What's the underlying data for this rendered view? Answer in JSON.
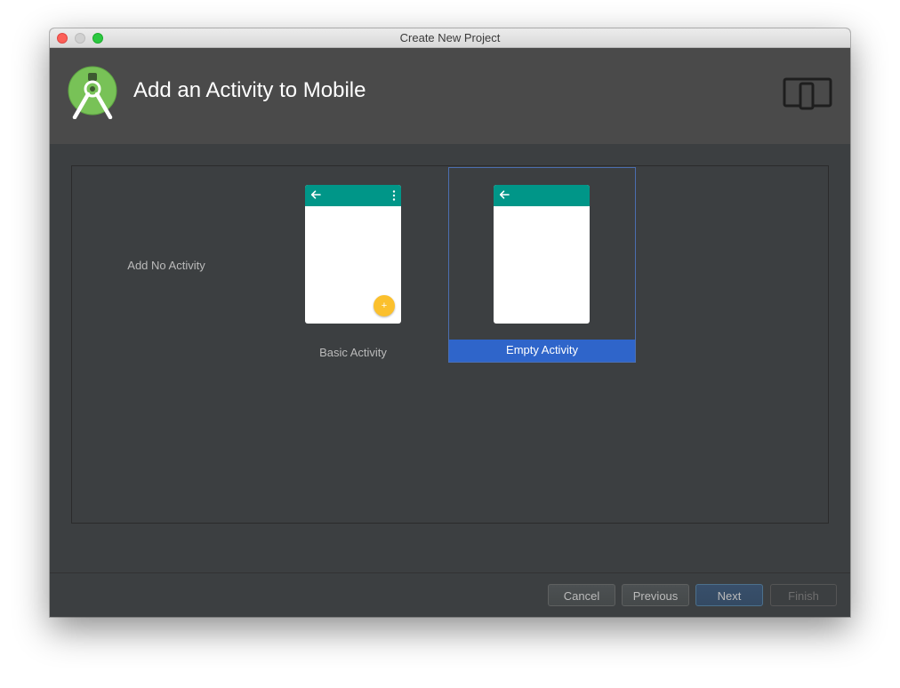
{
  "window": {
    "title": "Create New Project"
  },
  "header": {
    "title": "Add an Activity to Mobile",
    "logo_icon": "android-studio-logo-icon",
    "device_icon": "tablet-phone-icon"
  },
  "gallery": {
    "templates": [
      {
        "label": "Add No Activity",
        "selected": false
      },
      {
        "label": "Basic Activity",
        "selected": false
      },
      {
        "label": "Empty Activity",
        "selected": true
      }
    ]
  },
  "footer": {
    "cancel_label": "Cancel",
    "previous_label": "Previous",
    "next_label": "Next",
    "finish_label": "Finish",
    "finish_enabled": false
  },
  "colors": {
    "window_bg": "#3c3f41",
    "header_bg": "#4a4a4a",
    "selection_blue": "#2f65ca",
    "app_bar_teal": "#009688",
    "fab_yellow": "#fbc02d"
  }
}
